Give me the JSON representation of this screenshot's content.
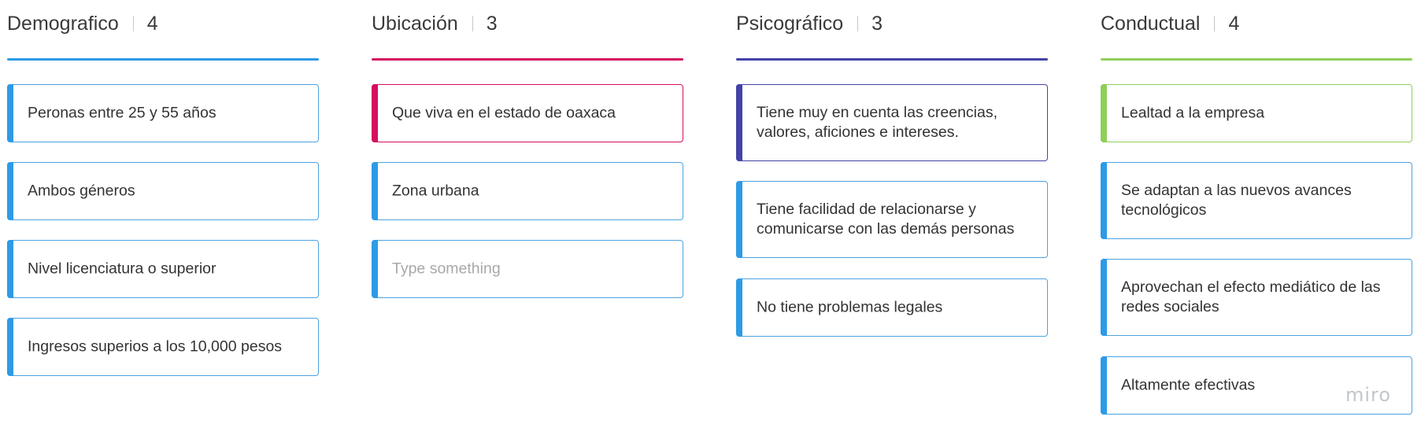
{
  "colors": {
    "demografico": "#2d9be6",
    "ubicacion": "#d40e5f",
    "psicografico": "#4343a8",
    "conductual": "#8fcf59",
    "card_default_border": "#4da3e0",
    "card_default_bar": "#2d9be6"
  },
  "columns": [
    {
      "title": "Demografico",
      "count": "4",
      "cards": [
        {
          "text": "Peronas entre 25 y 55 años"
        },
        {
          "text": "Ambos géneros"
        },
        {
          "text": "Nivel licenciatura o superior"
        },
        {
          "text": "Ingresos superios a los 10,000 pesos"
        }
      ]
    },
    {
      "title": "Ubicación",
      "count": "3",
      "cards": [
        {
          "text": "Que viva en el estado de oaxaca"
        },
        {
          "text": "Zona urbana"
        },
        {
          "text": "Type something"
        }
      ]
    },
    {
      "title": "Psicográfico",
      "count": "3",
      "cards": [
        {
          "text": "Tiene muy en cuenta las creencias, valores, aficiones e intereses."
        },
        {
          "text": "Tiene facilidad de relacionarse y comunicarse con las demás personas"
        },
        {
          "text": "No tiene problemas legales"
        }
      ]
    },
    {
      "title": "Conductual",
      "count": "4",
      "cards": [
        {
          "text": "Lealtad a la empresa"
        },
        {
          "text": "Se adaptan a las nuevos avances tecnológicos"
        },
        {
          "text": "Aprovechan el efecto mediático de las redes sociales"
        },
        {
          "text": "Altamente efectivas"
        }
      ]
    }
  ],
  "watermark": "miro"
}
